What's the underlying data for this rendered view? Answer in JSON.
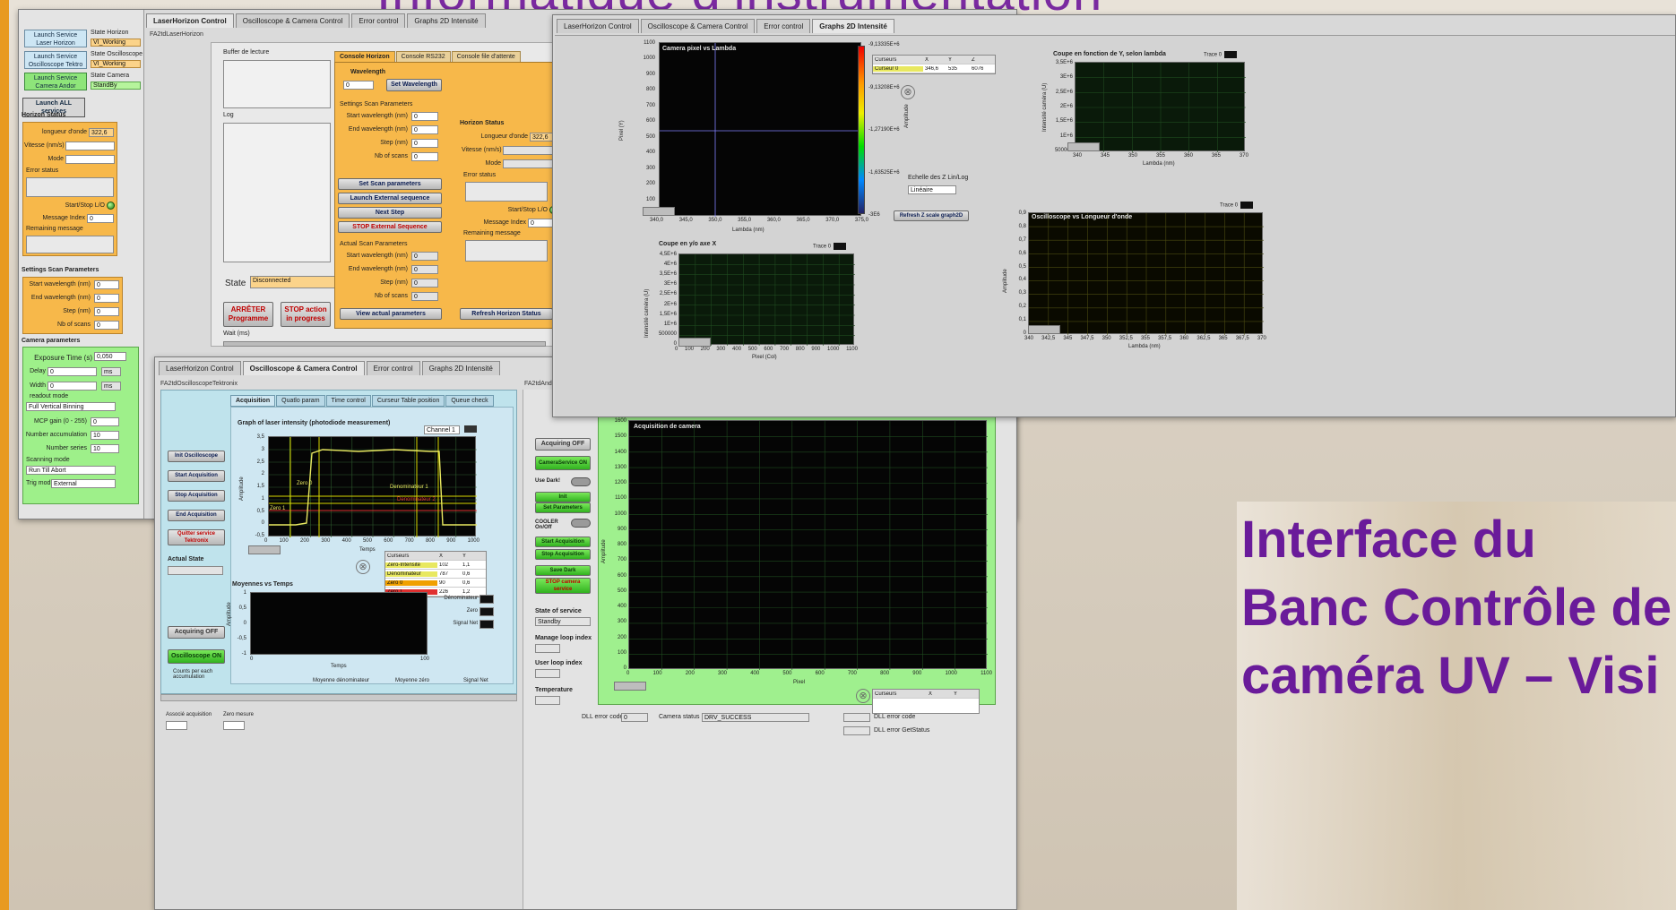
{
  "slide": {
    "title": "Informatique d’instrumentation",
    "caption": [
      "Interface du",
      "Banc Contrôle de",
      "caméra UV – Visi"
    ]
  },
  "win_horizon": {
    "tabs": [
      "LaserHorizon Control",
      "Oscilloscope & Camera Control",
      "Error control",
      "Graphs 2D Intensité"
    ],
    "path": "FA2tdLaserHorizon",
    "launch": [
      {
        "button": "Launch Service Laser Horizon",
        "state_label": "State Horizon",
        "state": "VI_Working"
      },
      {
        "button": "Launch Service Oscilloscope Tektro",
        "state_label": "State Oscilloscope",
        "state": "VI_Working"
      },
      {
        "button": "Launch Service Camera Andor",
        "state_label": "State Camera",
        "state": "StandBy"
      }
    ],
    "launch_all": "Launch ALL services",
    "horizon_status": {
      "title": "Horizon Status",
      "wavelength_label": "longueur d'onde",
      "wavelength_value": "322,6",
      "vitesse_label": "Vitesse (nm/s)",
      "mode_label": "Mode",
      "error_label": "Error status",
      "start_stop_label": "Start/Stop L/O",
      "message_index_label": "Message Index",
      "message_index_value": "0",
      "remaining_label": "Remaining message"
    },
    "scan": {
      "title": "Settings Scan Parameters",
      "rows": [
        {
          "label": "Start wavelength (nm)",
          "value": "0"
        },
        {
          "label": "End wavelength (nm)",
          "value": "0"
        },
        {
          "label": "Step (nm)",
          "value": "0"
        },
        {
          "label": "Nb of scans",
          "value": "0"
        }
      ]
    },
    "camera": {
      "title": "Camera parameters",
      "exposure_label": "Exposure Time (s)",
      "exposure_value": "0,050",
      "delay_label": "Delay",
      "delay_value": "0",
      "width_label": "Width",
      "width_value": "0",
      "unit": "ms",
      "readout_label": "readout mode",
      "readout_value": "Full Vertical Binning",
      "mcp_label": "MCP gain (0 - 255)",
      "mcp_value": "0",
      "accum_label": "Number accumulation",
      "accum_value": "10",
      "series_label": "Number series",
      "series_value": "10",
      "scanning_label": "Scanning mode",
      "scanning_value": "Run Till Abort",
      "trig_label": "Trig mod",
      "trig_value": "External"
    },
    "buffer_label": "Buffer de lecture",
    "log_label": "Log",
    "state_label": "State",
    "state_value": "Disconnected",
    "stop_prog": "ARRÊTER Programme",
    "stop_action": "STOP action in progress",
    "wait_label": "Wait (ms)",
    "console_tabs": [
      "Console Horizon",
      "Console RS232",
      "Console file d'attente"
    ],
    "wavelength_title": "Wavelength",
    "wavelength_field": "0",
    "set_wavelength": "Set Wavelength",
    "console_scan_rows": [
      {
        "label": "Start wavelength (nm)",
        "value": "0"
      },
      {
        "label": "End wavelength (nm)",
        "value": "0"
      },
      {
        "label": "Step (nm)",
        "value": "0"
      },
      {
        "label": "Nb of scans",
        "value": "0"
      }
    ],
    "seq_buttons": [
      "Set Scan parameters",
      "Launch External sequence",
      "Next Step",
      "STOP External Sequence"
    ],
    "actual_title": "Actual Scan Parameters",
    "actual_rows": [
      {
        "label": "Start wavelength (nm)",
        "value": "0"
      },
      {
        "label": "End wavelength (nm)",
        "value": "0"
      },
      {
        "label": "Step (nm)",
        "value": "0"
      },
      {
        "label": "Nb of scans",
        "value": "0"
      }
    ],
    "view_actual": "View actual parameters",
    "hs2": {
      "title": "Horizon Status",
      "longueur_label": "Longueur d'onde",
      "longueur_value": "322,6",
      "vitesse_label": "Vitesse (nm/s)",
      "mode_label": "Mode",
      "error_label": "Error status",
      "start_stop_label": "Start/Stop L/O",
      "message_index_label": "Message Index",
      "message_index_value": "0",
      "remaining_label": "Remaining message"
    },
    "refresh_horizon": "Refresh Horizon Status"
  },
  "win_graphs": {
    "tabs": [
      "LaserHorizon Control",
      "Oscilloscope & Camera Control",
      "Error control",
      "Graphs 2D Intensité"
    ],
    "camera_plot": {
      "title": "Camera pixel vs Lambda",
      "ylabel": "Pixel (Y)",
      "xlabel": "Lambda (nm)",
      "yticks": [
        "1100",
        "1000",
        "900",
        "800",
        "700",
        "600",
        "500",
        "400",
        "300",
        "200",
        "100",
        "0"
      ],
      "xticks": [
        "340,0",
        "345,0",
        "350,0",
        "355,0",
        "360,0",
        "365,0",
        "370,0",
        "375,0"
      ]
    },
    "colorbar_ticks": [
      "-9,13335E+6",
      "-9,13208E+6",
      "-1,27190E+6",
      "-1,63525E+6",
      "-3E6"
    ],
    "colorbar_label": "Amplitude",
    "cursor_table": {
      "headers": [
        "Curseurs",
        "X",
        "Y",
        "Z"
      ],
      "row": [
        "Curseur 0",
        "346,6",
        "535",
        "6076"
      ]
    },
    "echelle_label": "Echelle des Z Lin/Log",
    "echelle_value": "Linéaire",
    "refresh_button": "Refresh Z scale graph2D",
    "coupe_x": {
      "title": "Coupe en y/o axe X",
      "trace": "Trace 0",
      "yticks": [
        "4,5E+6",
        "4E+6",
        "3,5E+6",
        "3E+6",
        "2,5E+6",
        "2E+6",
        "1,5E+6",
        "1E+6",
        "500000",
        "0"
      ],
      "xticks": [
        "0",
        "100",
        "200",
        "300",
        "400",
        "500",
        "600",
        "700",
        "800",
        "900",
        "1000",
        "1100"
      ],
      "xlabel": "Pixel (Col)",
      "ylabel": "Intensité caméra (U)"
    },
    "coupe_y": {
      "title": "Coupe en fonction de Y, selon lambda",
      "trace": "Trace 0",
      "yticks": [
        "3,5E+6",
        "3E+6",
        "2,5E+6",
        "2E+6",
        "1,5E+6",
        "1E+6",
        "500000"
      ],
      "xticks": [
        "340",
        "345",
        "350",
        "355",
        "360",
        "365",
        "370"
      ],
      "xlabel": "Lambda (nm)",
      "ylabel": "Intensité caméra (U)"
    },
    "osc_lambda": {
      "title": "Oscilloscope vs Longueur d'onde",
      "trace": "Trace 0",
      "yticks": [
        "0,9",
        "0,8",
        "0,7",
        "0,6",
        "0,5",
        "0,4",
        "0,3",
        "0,2",
        "0,1",
        "0"
      ],
      "xticks": [
        "340",
        "342,5",
        "345",
        "347,5",
        "350",
        "352,5",
        "355",
        "357,5",
        "360",
        "362,5",
        "365",
        "367,5",
        "370"
      ],
      "xlabel": "Lambda (nm)",
      "ylabel": "Amplitude"
    }
  },
  "win_oscillo": {
    "tabs": [
      "LaserHorizon Control",
      "Oscilloscope & Camera Control",
      "Error control",
      "Graphs 2D Intensité"
    ],
    "path_left": "FA2tdOscilloscopeTektronix",
    "path_right": "FA2tdAndor",
    "sub_tabs": [
      "Acquisition",
      "Quatlo param",
      "Time control",
      "Curseur Table position",
      "Queue check"
    ],
    "left_buttons": [
      "Init Oscilloscope",
      "Start Acquisition",
      "Stop Acquisition",
      "End Acquisition",
      "Quitter service Tektronix"
    ],
    "actual_state_label": "Actual State",
    "acquiring_off": "Acquiring OFF",
    "oscillo_on": "Oscilloscope ON",
    "counts_label": "Counts per each accumulation",
    "plot1": {
      "title": "Graph of laser intensity (photodiode measurement)",
      "channel": "Channel 1",
      "yticks": [
        "3,5",
        "3",
        "2,5",
        "2",
        "1,5",
        "1",
        "0,5",
        "0",
        "-0,5"
      ],
      "xticks": [
        "0",
        "100",
        "200",
        "300",
        "400",
        "500",
        "600",
        "700",
        "800",
        "900",
        "1000"
      ],
      "xlabel": "Temps",
      "ylabel": "Amplitude",
      "markers": [
        "Zero 0",
        "Zero 1",
        "Denominateur 1",
        "Denominateur 2"
      ]
    },
    "cursor_table": {
      "headers": [
        "Curseurs",
        "X",
        "Y"
      ],
      "rows": [
        [
          "Zero-Intensité",
          "102",
          "1,1"
        ],
        [
          "Dénominateur",
          "787",
          "0,6"
        ],
        [
          "Zero 0",
          "90",
          "0,6"
        ],
        [
          "Zero 1",
          "226",
          "1,2"
        ]
      ]
    },
    "mean_labels": [
      "Dénominateur",
      "Zero",
      "Signal Net"
    ],
    "plot2": {
      "title": "Moyennes vs Temps",
      "yticks": [
        "1",
        "0,5",
        "0",
        "-0,5",
        "-1"
      ],
      "xticks": [
        "0",
        "100"
      ],
      "xlabel": "Temps",
      "ylabel": "Amplitude"
    },
    "footer_labels": [
      "Moyenne dénominateur",
      "Moyenne zéro",
      "Signal Net"
    ],
    "bottom_fields": [
      "Associé acquisition",
      "Zero mesure"
    ],
    "cam_plot": {
      "title": "Acquisition de camera",
      "yticks": [
        "1600",
        "1500",
        "1400",
        "1300",
        "1200",
        "1100",
        "1000",
        "900",
        "800",
        "700",
        "600",
        "500",
        "400",
        "300",
        "200",
        "100",
        "0"
      ],
      "xticks": [
        "0",
        "100",
        "200",
        "300",
        "400",
        "500",
        "600",
        "700",
        "800",
        "900",
        "1000",
        "1100"
      ],
      "xlabel": "Pixel",
      "ylabel": "Amplitude"
    },
    "right_controls": [
      "Use Dark!",
      "Init",
      "Set Parameters",
      "COOLER On/Off",
      "Start Acquisition",
      "Stop Acquisition",
      "Save Dark",
      "STOP camera service"
    ],
    "acquiring_off2": "Acquiring OFF",
    "camera_on": "CameraService ON",
    "state_service_label": "State of service",
    "state_service_value": "Standby",
    "manage_loop_label": "Manage loop index",
    "user_loop_label": "User loop index",
    "temperature_label": "Temperature",
    "cursor_headers": [
      "Curseurs",
      "X",
      "Y"
    ],
    "dll_error_label": "DLL error code",
    "dll_error_value": "0",
    "camera_status_label": "Camera status",
    "camera_status_value": "DRV_SUCCESS",
    "dll_err_side": [
      "DLL error code",
      "DLL error GetStatus"
    ]
  }
}
